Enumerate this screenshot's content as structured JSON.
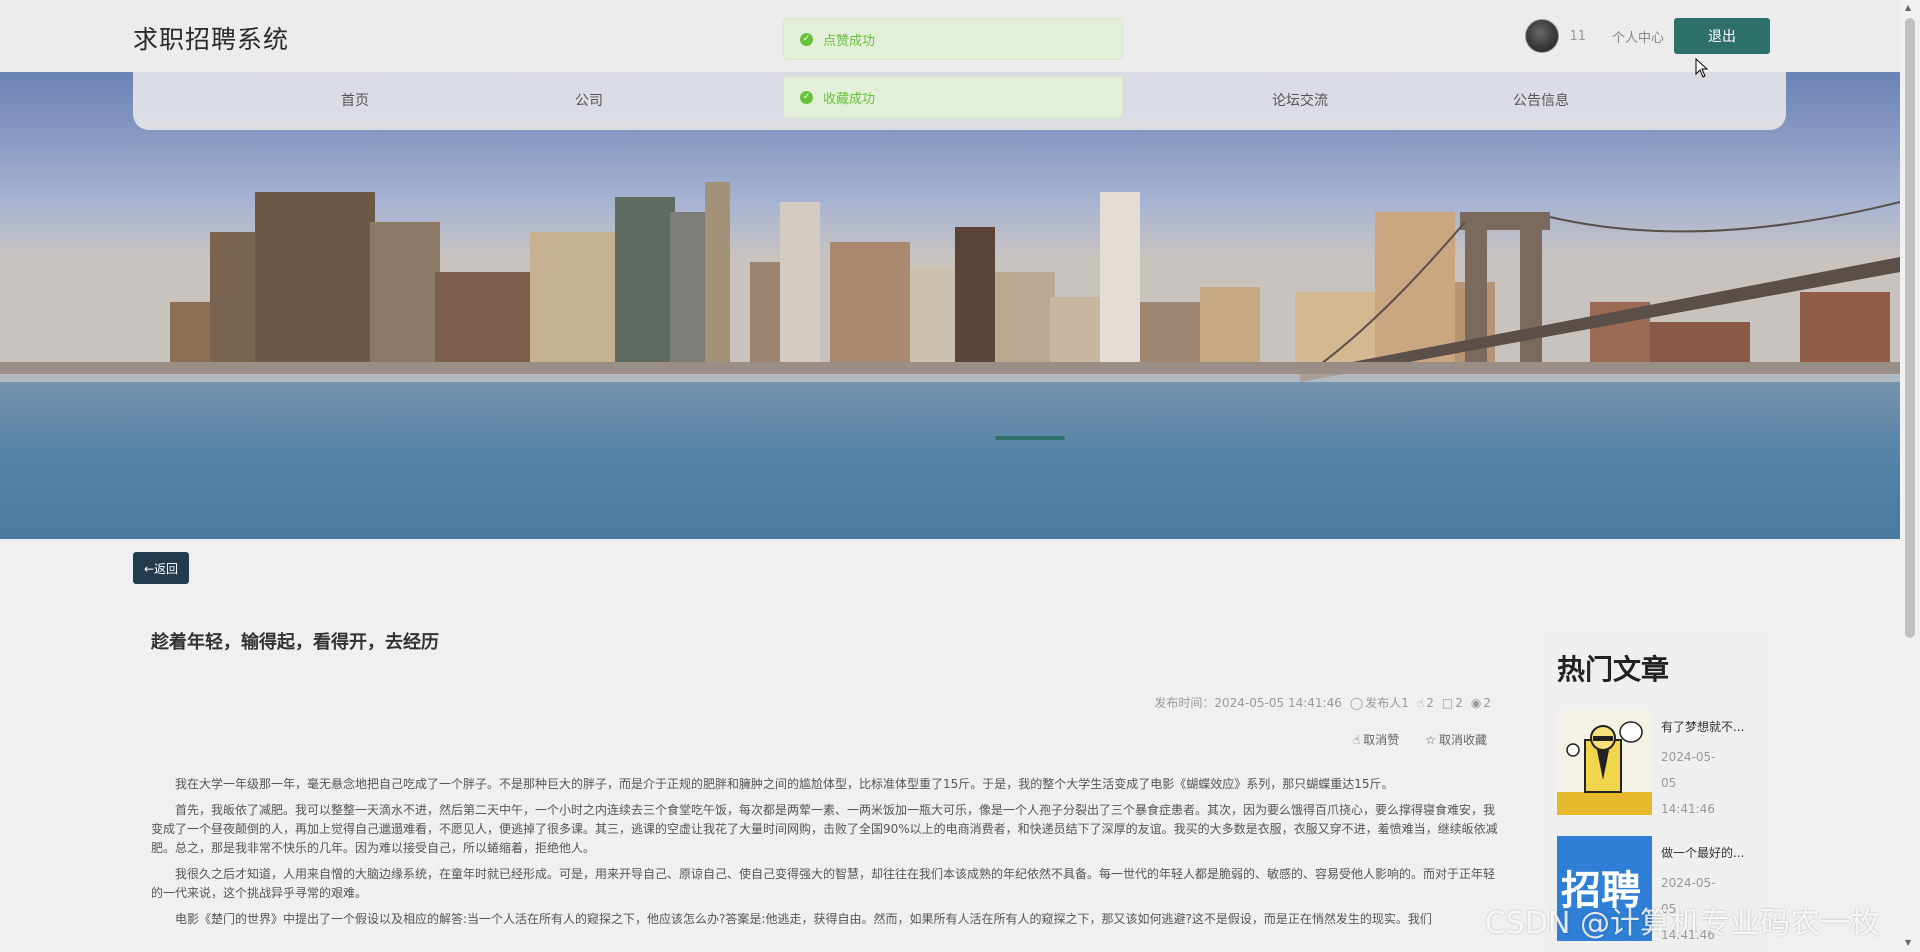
{
  "header": {
    "brand": "求职招聘系统",
    "username": "11",
    "user_center": "个人中心",
    "logout": "退出"
  },
  "nav": {
    "items": [
      "首页",
      "公司",
      "论坛交流",
      "公告信息"
    ]
  },
  "toasts": [
    "点赞成功",
    "收藏成功"
  ],
  "back_label": "←返回",
  "article": {
    "title": "趁着年轻，输得起，看得开，去经历",
    "meta": {
      "publish": "发布时间：2024-05-05 14:41:46",
      "author": "发布人1",
      "likes": "2",
      "comments": "2",
      "views": "2"
    },
    "actions": {
      "unlike": "取消赞",
      "unfavorite": "取消收藏"
    },
    "paragraphs": [
      "我在大学一年级那一年，毫无悬念地把自己吃成了一个胖子。不是那种巨大的胖子，而是介于正规的肥胖和臃肿之间的尴尬体型，比标准体型重了15斤。于是，我的整个大学生活变成了电影《蝴蝶效应》系列，那只蝴蝶重达15斤。",
      "首先，我皈依了减肥。我可以整整一天滴水不进，然后第二天中午，一个小时之内连续去三个食堂吃午饭，每次都是两荤一素、一两米饭加一瓶大可乐，像是一个人孢子分裂出了三个暴食症患者。其次，因为要么饿得百爪挠心，要么撑得寝食难安，我变成了一个昼夜颠倒的人，再加上觉得自己邋遢难看，不愿见人，便逃掉了很多课。其三，逃课的空虚让我花了大量时间网购，击败了全国90%以上的电商消费者，和快递员结下了深厚的友谊。我买的大多数是衣服，衣服又穿不进，羞愤难当，继续皈依减肥。总之，那是我非常不快乐的几年。因为难以接受自己，所以蜷缩着，拒绝他人。",
      "我很久之后才知道，人用来自憎的大脑边缘系统，在童年时就已经形成。可是，用来开导自己、原谅自己、使自己变得强大的智慧，却往往在我们本该成熟的年纪依然不具备。每一世代的年轻人都是脆弱的、敏感的、容易受他人影响的。而对于正年轻的一代来说，这个挑战异乎寻常的艰难。",
      "电影《楚门的世界》中提出了一个假设以及相应的解答:当一个人活在所有人的窥探之下，他应该怎么办?答案是:他逃走，获得自由。然而，如果所有人活在所有人的窥探之下，那又该如何逃避?这不是假设，而是正在悄然发生的现实。我们"
    ]
  },
  "sidebar": {
    "title": "热门文章",
    "items": [
      {
        "name": "有了梦想就不...",
        "date": "2024-05-05 14:41:46"
      },
      {
        "name": "做一个最好的...",
        "date": "2024-05-05 14:41:46",
        "thumb_text": "招聘"
      }
    ]
  },
  "watermark": "CSDN @计算机专业码农一枚",
  "colors": {
    "accent": "#2f6f6a",
    "back_button": "#233b4e",
    "toast_text": "#67c23a",
    "toast_bg": "#e3efd9"
  }
}
